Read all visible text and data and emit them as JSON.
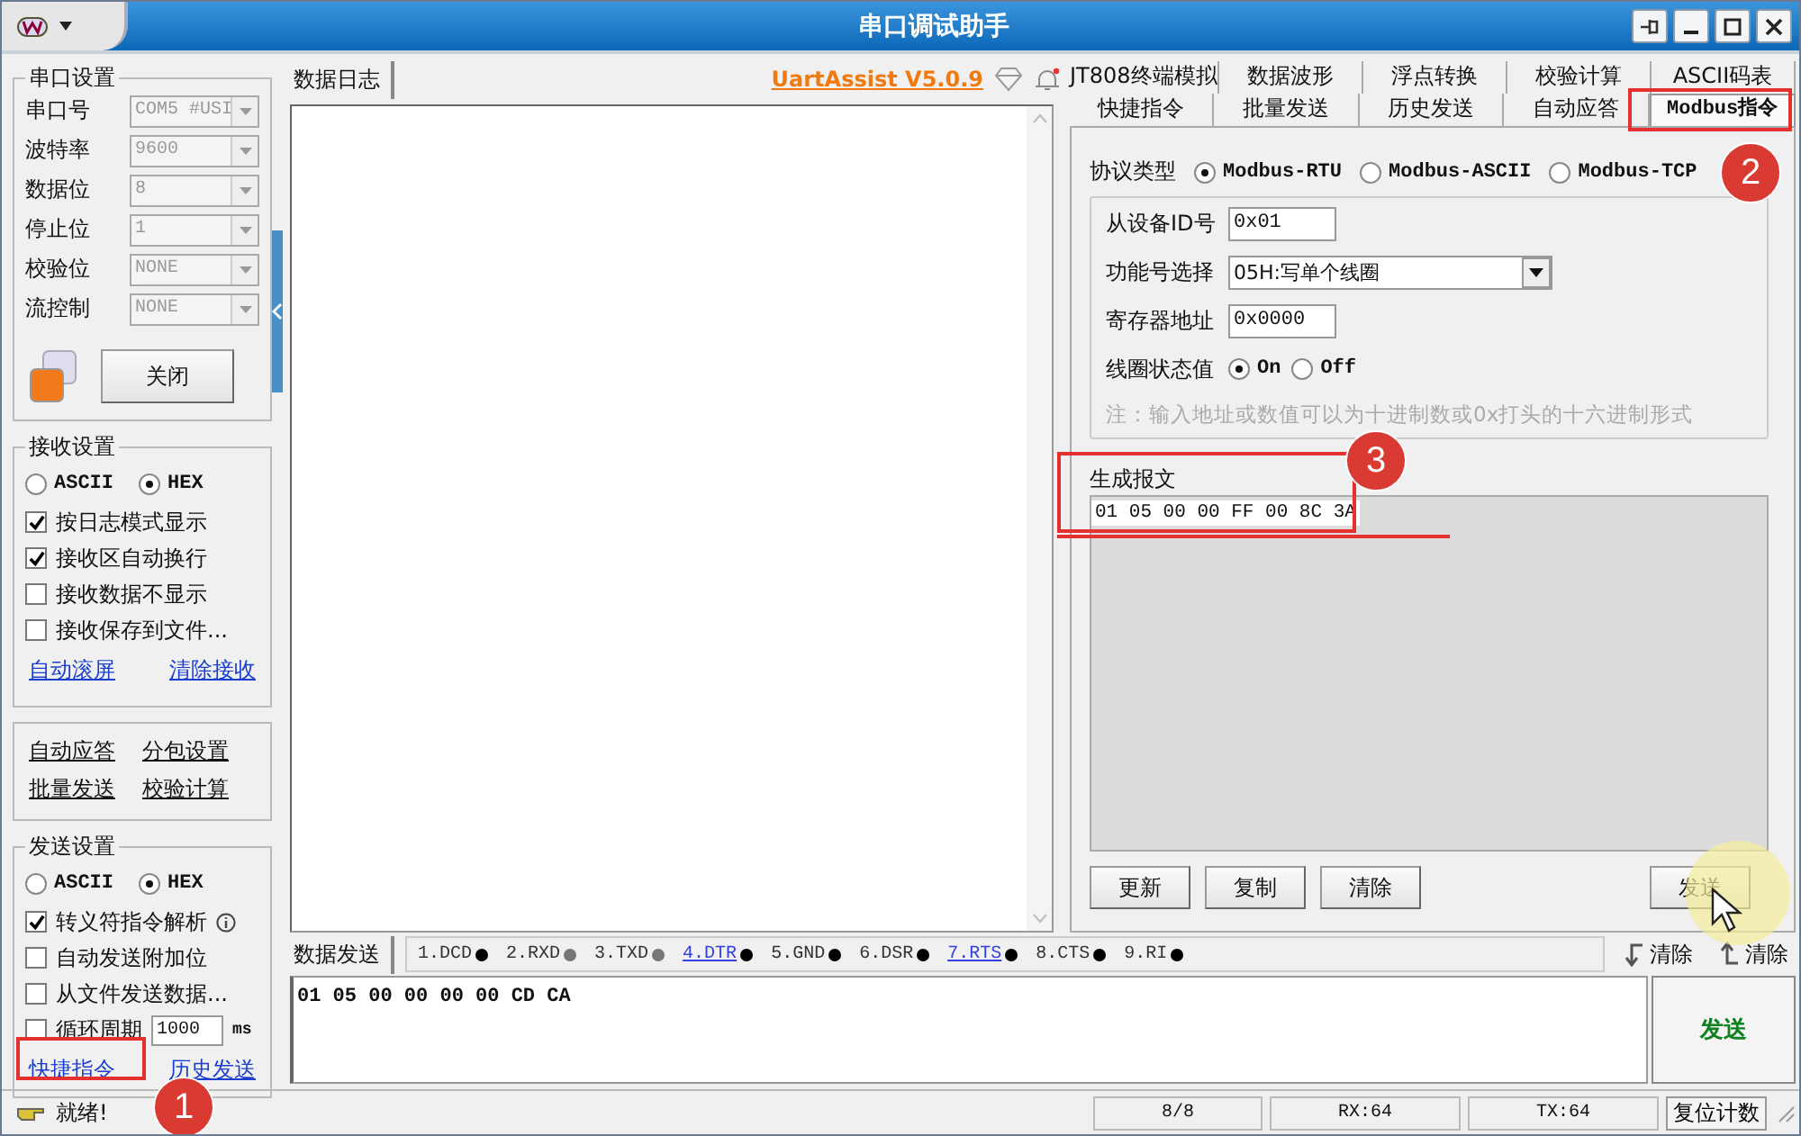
{
  "window": {
    "title": "串口调试助手"
  },
  "serial_settings": {
    "title": "串口设置",
    "fields": [
      {
        "label": "串口号",
        "value": "COM5 #USI",
        "disabled": true
      },
      {
        "label": "波特率",
        "value": "9600",
        "disabled": true
      },
      {
        "label": "数据位",
        "value": "8",
        "disabled": true
      },
      {
        "label": "停止位",
        "value": "1",
        "disabled": true
      },
      {
        "label": "校验位",
        "value": "NONE",
        "disabled": true
      },
      {
        "label": "流控制",
        "value": "NONE",
        "disabled": true
      }
    ],
    "port_open": true,
    "close_button": "关闭"
  },
  "receive_settings": {
    "title": "接收设置",
    "modes": [
      {
        "label": "ASCII",
        "selected": false
      },
      {
        "label": "HEX",
        "selected": true
      }
    ],
    "options": [
      {
        "label": "按日志模式显示",
        "checked": true
      },
      {
        "label": "接收区自动换行",
        "checked": true
      },
      {
        "label": "接收数据不显示",
        "checked": false
      },
      {
        "label": "接收保存到文件...",
        "checked": false
      }
    ],
    "links": [
      "自动滚屏",
      "清除接收"
    ]
  },
  "tool_links": [
    "自动应答",
    "分包设置",
    "批量发送",
    "校验计算"
  ],
  "send_settings": {
    "title": "发送设置",
    "modes": [
      {
        "label": "ASCII",
        "selected": false
      },
      {
        "label": "HEX",
        "selected": true
      }
    ],
    "options": [
      {
        "label": "转义符指令解析",
        "checked": true,
        "has_info": true
      },
      {
        "label": "自动发送附加位",
        "checked": false
      },
      {
        "label": "从文件发送数据...",
        "checked": false
      }
    ],
    "cycle": {
      "label": "循环周期",
      "checked": false,
      "value": "1000",
      "unit": "ms"
    },
    "links": [
      "快捷指令",
      "历史发送"
    ]
  },
  "log": {
    "tab": "数据日志",
    "version_link": "UartAssist V5.0.9"
  },
  "right_tabs": [
    [
      {
        "label": "JT808终端模拟",
        "selected": false
      },
      {
        "label": "数据波形",
        "selected": false
      },
      {
        "label": "浮点转换",
        "selected": false
      },
      {
        "label": "校验计算",
        "selected": false
      },
      {
        "label": "ASCII码表",
        "selected": false
      }
    ],
    [
      {
        "label": "快捷指令",
        "selected": false
      },
      {
        "label": "批量发送",
        "selected": false
      },
      {
        "label": "历史发送",
        "selected": false
      },
      {
        "label": "自动应答",
        "selected": false
      },
      {
        "label": "Modbus指令",
        "selected": true
      }
    ]
  ],
  "modbus": {
    "protocol_label": "协议类型",
    "protocols": [
      {
        "label": "Modbus-RTU",
        "selected": true
      },
      {
        "label": "Modbus-ASCII",
        "selected": false
      },
      {
        "label": "Modbus-TCP",
        "selected": false
      }
    ],
    "fields": [
      {
        "label": "从设备ID号",
        "value": "0x01",
        "kind": "input"
      },
      {
        "label": "功能号选择",
        "value": "05H:写单个线圈",
        "kind": "select"
      },
      {
        "label": "寄存器地址",
        "value": "0x0000",
        "kind": "input"
      }
    ],
    "coil_label": "线圈状态值",
    "coil_states": [
      {
        "label": "On",
        "selected": true
      },
      {
        "label": "Off",
        "selected": false
      }
    ],
    "note": "注：输入地址或数值可以为十进制数或0x打头的十六进制形式",
    "output_label": "生成报文",
    "output_value": "01 05 00 00 FF 00 8C 3A",
    "buttons": [
      "更新",
      "复制",
      "清除"
    ],
    "send_button": "发送"
  },
  "send_area": {
    "tab": "数据发送",
    "signals": [
      {
        "label": "1.DCD",
        "link": false,
        "on": true
      },
      {
        "label": "2.RXD",
        "link": false,
        "on": false
      },
      {
        "label": "3.TXD",
        "link": false,
        "on": false
      },
      {
        "label": "4.DTR",
        "link": true,
        "on": true
      },
      {
        "label": "5.GND",
        "link": false,
        "on": true
      },
      {
        "label": "6.DSR",
        "link": false,
        "on": true
      },
      {
        "label": "7.RTS",
        "link": true,
        "on": true
      },
      {
        "label": "8.CTS",
        "link": false,
        "on": true
      },
      {
        "label": "9.RI",
        "link": false,
        "on": true
      }
    ],
    "clear_buttons": [
      {
        "label": "清除",
        "kind": "receive"
      },
      {
        "label": "清除",
        "kind": "send"
      }
    ],
    "value": "01 05 00 00 00 00 CD CA",
    "send_button": "发送"
  },
  "status_bar": {
    "status": "就绪!",
    "count": "8/8",
    "rx": "RX:64",
    "tx": "TX:64",
    "reset_button": "复位计数"
  },
  "annotations": [
    {
      "label": "1"
    },
    {
      "label": "2"
    },
    {
      "label": "3"
    }
  ]
}
